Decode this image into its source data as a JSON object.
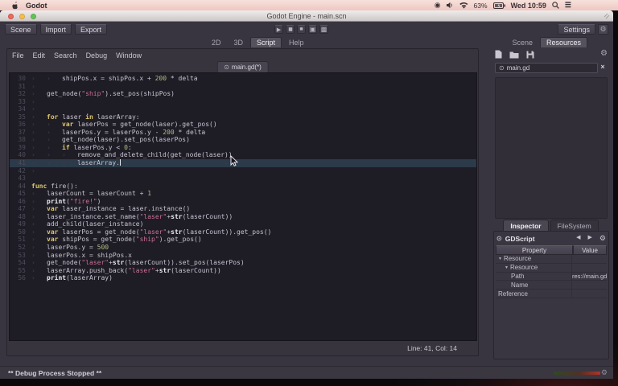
{
  "menubar": {
    "app_name": "Godot",
    "battery_pct": "63%",
    "clock": "Wed 10:59"
  },
  "window": {
    "title": "Godot Engine - main.scn"
  },
  "toolbar": {
    "buttons": [
      "Scene",
      "Import",
      "Export"
    ],
    "settings_label": "Settings",
    "workspace_tabs": [
      "2D",
      "3D",
      "Script",
      "Help"
    ],
    "active_workspace": "Script",
    "dock_tabs": [
      "Scene",
      "Resources"
    ],
    "active_dock": "Resources"
  },
  "script_editor": {
    "menus": [
      "File",
      "Edit",
      "Search",
      "Debug",
      "Window"
    ],
    "tab_label": "main.gd(*)",
    "tab_icon": "script-circle-icon",
    "status": "Line: 41, Col: 14",
    "cursor": {
      "line": 41,
      "col": 14
    },
    "lines": [
      {
        "num": 30,
        "ind": 2,
        "parts": [
          [
            "n",
            "shipPos.x = shipPos.x + "
          ],
          [
            "d",
            "200"
          ],
          [
            "n",
            " * delta"
          ]
        ]
      },
      {
        "num": 31,
        "ind": 1,
        "parts": []
      },
      {
        "num": 32,
        "ind": 1,
        "parts": [
          [
            "n",
            "get_node("
          ],
          [
            "s",
            "\"ship\""
          ],
          [
            "n",
            ").set_pos(shipPos)"
          ]
        ]
      },
      {
        "num": 33,
        "ind": 1,
        "parts": []
      },
      {
        "num": 34,
        "ind": 1,
        "parts": []
      },
      {
        "num": 35,
        "ind": 1,
        "parts": [
          [
            "k",
            "for "
          ],
          [
            "n",
            "laser "
          ],
          [
            "k",
            "in "
          ],
          [
            "n",
            "laserArray:"
          ]
        ]
      },
      {
        "num": 36,
        "ind": 2,
        "parts": [
          [
            "k",
            "var "
          ],
          [
            "n",
            "laserPos = get_node(laser).get_pos()"
          ]
        ]
      },
      {
        "num": 37,
        "ind": 2,
        "parts": [
          [
            "n",
            "laserPos.y = laserPos.y - "
          ],
          [
            "d",
            "200"
          ],
          [
            "n",
            " * delta"
          ]
        ]
      },
      {
        "num": 38,
        "ind": 2,
        "parts": [
          [
            "n",
            "get_node(laser).set_pos(laserPos)"
          ]
        ]
      },
      {
        "num": 39,
        "ind": 2,
        "parts": [
          [
            "k",
            "if "
          ],
          [
            "n",
            "laserPos.y < "
          ],
          [
            "d",
            "0"
          ],
          [
            "n",
            ":"
          ]
        ]
      },
      {
        "num": 40,
        "ind": 3,
        "parts": [
          [
            "n",
            "remove_and_delete_child(get_node(laser))"
          ]
        ]
      },
      {
        "num": 41,
        "ind": 3,
        "parts": [
          [
            "n",
            "laserArray."
          ]
        ]
      },
      {
        "num": 42,
        "ind": 1,
        "parts": []
      },
      {
        "num": 43,
        "ind": 0,
        "parts": []
      },
      {
        "num": 44,
        "ind": 0,
        "parts": [
          [
            "k",
            "func "
          ],
          [
            "n",
            "fire():"
          ]
        ]
      },
      {
        "num": 45,
        "ind": 1,
        "parts": [
          [
            "n",
            "laserCount = laserCount + "
          ],
          [
            "d",
            "1"
          ]
        ]
      },
      {
        "num": 46,
        "ind": 1,
        "parts": [
          [
            "b",
            "print"
          ],
          [
            "n",
            "("
          ],
          [
            "s",
            "\"fire!\""
          ],
          [
            "n",
            ")"
          ]
        ]
      },
      {
        "num": 47,
        "ind": 1,
        "parts": [
          [
            "k",
            "var "
          ],
          [
            "n",
            "laser_instance = laser.instance()"
          ]
        ]
      },
      {
        "num": 48,
        "ind": 1,
        "parts": [
          [
            "n",
            "laser_instance.set_name("
          ],
          [
            "s",
            "\"laser\""
          ],
          [
            "n",
            "+"
          ],
          [
            "b",
            "str"
          ],
          [
            "n",
            "(laserCount))"
          ]
        ]
      },
      {
        "num": 49,
        "ind": 1,
        "parts": [
          [
            "n",
            "add_child(laser_instance)"
          ]
        ]
      },
      {
        "num": 50,
        "ind": 1,
        "parts": [
          [
            "k",
            "var "
          ],
          [
            "n",
            "laserPos = get_node("
          ],
          [
            "s",
            "\"laser\""
          ],
          [
            "n",
            "+"
          ],
          [
            "b",
            "str"
          ],
          [
            "n",
            "(laserCount)).get_pos()"
          ]
        ]
      },
      {
        "num": 51,
        "ind": 1,
        "parts": [
          [
            "k",
            "var "
          ],
          [
            "n",
            "shipPos = get_node("
          ],
          [
            "s",
            "\"ship\""
          ],
          [
            "n",
            ").get_pos()"
          ]
        ]
      },
      {
        "num": 52,
        "ind": 1,
        "parts": [
          [
            "n",
            "laserPos.y = "
          ],
          [
            "d",
            "500"
          ]
        ]
      },
      {
        "num": 53,
        "ind": 1,
        "parts": [
          [
            "n",
            "laserPos.x = shipPos.x"
          ]
        ]
      },
      {
        "num": 54,
        "ind": 1,
        "parts": [
          [
            "n",
            "get_node("
          ],
          [
            "s",
            "\"laser\""
          ],
          [
            "n",
            "+"
          ],
          [
            "b",
            "str"
          ],
          [
            "n",
            "(laserCount)).set_pos(laserPos)"
          ]
        ]
      },
      {
        "num": 55,
        "ind": 1,
        "parts": [
          [
            "n",
            "laserArray.push_back("
          ],
          [
            "s",
            "\"laser\""
          ],
          [
            "n",
            "+"
          ],
          [
            "b",
            "str"
          ],
          [
            "n",
            "(laserCount))"
          ]
        ]
      },
      {
        "num": 56,
        "ind": 1,
        "parts": [
          [
            "b",
            "print"
          ],
          [
            "n",
            "(laserArray)"
          ]
        ]
      }
    ]
  },
  "resources_panel": {
    "open_file": "main.gd"
  },
  "inspector": {
    "tabs": [
      "Inspector",
      "FileSystem"
    ],
    "active_tab": "Inspector",
    "object_type": "GDScript",
    "columns": [
      "Property",
      "Value"
    ],
    "rows": [
      {
        "label": "Resource",
        "indent": 0,
        "expand": true,
        "value": ""
      },
      {
        "label": "Resource",
        "indent": 1,
        "expand": true,
        "value": ""
      },
      {
        "label": "Path",
        "indent": 2,
        "expand": false,
        "value": "res://main.gd"
      },
      {
        "label": "Name",
        "indent": 2,
        "expand": false,
        "value": ""
      },
      {
        "label": "Reference",
        "indent": 0,
        "expand": false,
        "value": ""
      }
    ]
  },
  "debugger": {
    "status_label": "** Debug Process Stopped **"
  },
  "colors": {
    "accent_current_line": "#2c3a49",
    "keyword": "#ddc76d",
    "string": "#c96f97",
    "editor_bg": "#1e1c25"
  }
}
